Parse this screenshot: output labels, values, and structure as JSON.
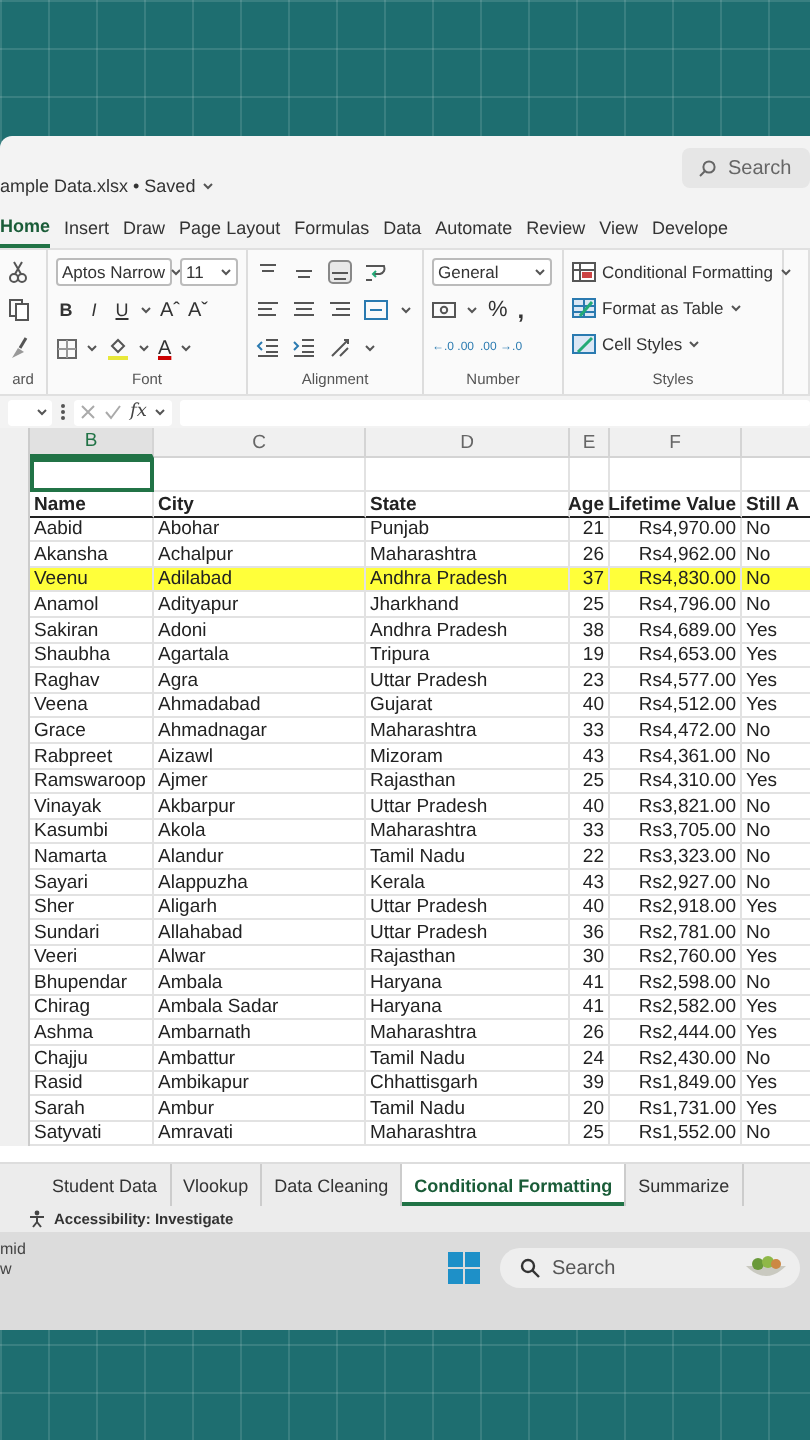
{
  "window": {
    "title": "ample Data.xlsx • Saved",
    "search_placeholder": "Search"
  },
  "ribbon_tabs": [
    {
      "label": "Home",
      "selected": true
    },
    {
      "label": "Insert",
      "selected": false
    },
    {
      "label": "Draw",
      "selected": false
    },
    {
      "label": "Page Layout",
      "selected": false
    },
    {
      "label": "Formulas",
      "selected": false
    },
    {
      "label": "Data",
      "selected": false
    },
    {
      "label": "Automate",
      "selected": false
    },
    {
      "label": "Review",
      "selected": false
    },
    {
      "label": "View",
      "selected": false
    },
    {
      "label": "Develope",
      "selected": false
    }
  ],
  "ribbon": {
    "clipboard_label": "ard",
    "font": {
      "name": "Aptos Narrow",
      "size": "11",
      "styles": [
        "B",
        "I",
        "U"
      ],
      "grow": "Aˆ",
      "shrink": "Aˇ",
      "color_button": "A",
      "label": "Font"
    },
    "alignment": {
      "label": "Alignment"
    },
    "number": {
      "format": "General",
      "percent": "%",
      "comma": ",",
      "increase_decimal": "←.0 .00",
      "decrease_decimal": ".00 →.0",
      "label": "Number"
    },
    "styles": {
      "items": [
        "Conditional Formatting",
        "Format as Table",
        "Cell Styles"
      ],
      "label": "Styles"
    }
  },
  "formula_bar": {
    "function_label": "fx"
  },
  "sheet": {
    "column_letters": [
      "B",
      "C",
      "D",
      "E",
      "F"
    ],
    "headers": [
      "Name",
      "City",
      "State",
      "Age",
      "Lifetime Value",
      "Still A"
    ],
    "rows": [
      {
        "cells": [
          "Aabid",
          "Abohar",
          "Punjab",
          "21",
          "Rs4,970.00",
          "No"
        ],
        "highlighted": false
      },
      {
        "cells": [
          "Akansha",
          "Achalpur",
          "Maharashtra",
          "26",
          "Rs4,962.00",
          "No"
        ],
        "highlighted": false
      },
      {
        "cells": [
          "Veenu",
          "Adilabad",
          "Andhra Pradesh",
          "37",
          "Rs4,830.00",
          "No"
        ],
        "highlighted": true
      },
      {
        "cells": [
          "Anamol",
          "Adityapur",
          "Jharkhand",
          "25",
          "Rs4,796.00",
          "No"
        ],
        "highlighted": false
      },
      {
        "cells": [
          "Sakiran",
          "Adoni",
          "Andhra Pradesh",
          "38",
          "Rs4,689.00",
          "Yes"
        ],
        "highlighted": false
      },
      {
        "cells": [
          "Shaubha",
          "Agartala",
          "Tripura",
          "19",
          "Rs4,653.00",
          "Yes"
        ],
        "highlighted": false
      },
      {
        "cells": [
          "Raghav",
          "Agra",
          "Uttar Pradesh",
          "23",
          "Rs4,577.00",
          "Yes"
        ],
        "highlighted": false
      },
      {
        "cells": [
          "Veena",
          "Ahmadabad",
          "Gujarat",
          "40",
          "Rs4,512.00",
          "Yes"
        ],
        "highlighted": false
      },
      {
        "cells": [
          "Grace",
          "Ahmadnagar",
          "Maharashtra",
          "33",
          "Rs4,472.00",
          "No"
        ],
        "highlighted": false
      },
      {
        "cells": [
          "Rabpreet",
          "Aizawl",
          "Mizoram",
          "43",
          "Rs4,361.00",
          "No"
        ],
        "highlighted": false
      },
      {
        "cells": [
          "Ramswaroop",
          "Ajmer",
          "Rajasthan",
          "25",
          "Rs4,310.00",
          "Yes"
        ],
        "highlighted": false
      },
      {
        "cells": [
          "Vinayak",
          "Akbarpur",
          "Uttar Pradesh",
          "40",
          "Rs3,821.00",
          "No"
        ],
        "highlighted": false
      },
      {
        "cells": [
          "Kasumbi",
          "Akola",
          "Maharashtra",
          "33",
          "Rs3,705.00",
          "No"
        ],
        "highlighted": false
      },
      {
        "cells": [
          "Namarta",
          "Alandur",
          "Tamil Nadu",
          "22",
          "Rs3,323.00",
          "No"
        ],
        "highlighted": false
      },
      {
        "cells": [
          "Sayari",
          "Alappuzha",
          "Kerala",
          "43",
          "Rs2,927.00",
          "No"
        ],
        "highlighted": false
      },
      {
        "cells": [
          "Sher",
          "Aligarh",
          "Uttar Pradesh",
          "40",
          "Rs2,918.00",
          "Yes"
        ],
        "highlighted": false
      },
      {
        "cells": [
          "Sundari",
          "Allahabad",
          "Uttar Pradesh",
          "36",
          "Rs2,781.00",
          "No"
        ],
        "highlighted": false
      },
      {
        "cells": [
          "Veeri",
          "Alwar",
          "Rajasthan",
          "30",
          "Rs2,760.00",
          "Yes"
        ],
        "highlighted": false
      },
      {
        "cells": [
          "Bhupendar",
          "Ambala",
          "Haryana",
          "41",
          "Rs2,598.00",
          "No"
        ],
        "highlighted": false
      },
      {
        "cells": [
          "Chirag",
          "Ambala Sadar",
          "Haryana",
          "41",
          "Rs2,582.00",
          "Yes"
        ],
        "highlighted": false
      },
      {
        "cells": [
          "Ashma",
          "Ambarnath",
          "Maharashtra",
          "26",
          "Rs2,444.00",
          "Yes"
        ],
        "highlighted": false
      },
      {
        "cells": [
          "Chajju",
          "Ambattur",
          "Tamil Nadu",
          "24",
          "Rs2,430.00",
          "No"
        ],
        "highlighted": false
      },
      {
        "cells": [
          "Rasid",
          "Ambikapur",
          "Chhattisgarh",
          "39",
          "Rs1,849.00",
          "Yes"
        ],
        "highlighted": false
      },
      {
        "cells": [
          "Sarah",
          "Ambur",
          "Tamil Nadu",
          "20",
          "Rs1,731.00",
          "Yes"
        ],
        "highlighted": false
      },
      {
        "cells": [
          "Satyvati",
          "Amravati",
          "Maharashtra",
          "25",
          "Rs1,552.00",
          "No"
        ],
        "highlighted": false
      }
    ]
  },
  "sheet_tabs": [
    {
      "label": "Student Data",
      "selected": false
    },
    {
      "label": "Vlookup",
      "selected": false
    },
    {
      "label": "Data Cleaning",
      "selected": false
    },
    {
      "label": "Conditional Formatting",
      "selected": true
    },
    {
      "label": "Summarize",
      "selected": false
    }
  ],
  "status_bar": {
    "accessibility": "Accessibility: Investigate"
  },
  "taskbar": {
    "weather_lines": [
      "mid",
      "w"
    ],
    "search_placeholder": "Search"
  }
}
